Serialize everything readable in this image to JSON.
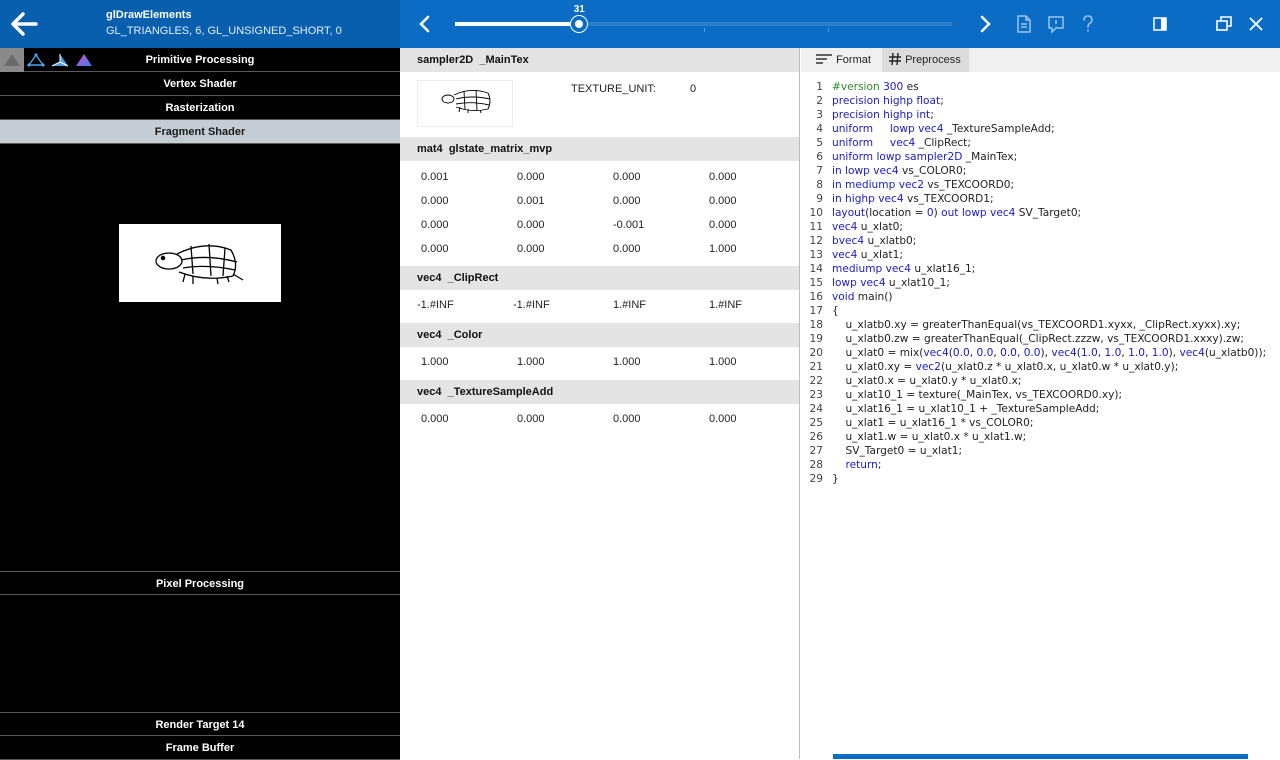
{
  "header": {
    "call_title": "glDrawElements",
    "call_args": "GL_TRIANGLES, 6, GL_UNSIGNED_SHORT, 0"
  },
  "timeline": {
    "current": "31",
    "progress": 0.25
  },
  "pipeline": {
    "stages": [
      "Primitive Processing",
      "Vertex Shader",
      "Rasterization",
      "Fragment Shader"
    ],
    "selected_stage": "Fragment Shader",
    "pixel_processing": "Pixel Processing",
    "render_target": "Render Target 14",
    "frame_buffer": "Frame Buffer"
  },
  "uniforms": {
    "tex": {
      "type": "sampler2D",
      "name": "_MainTex",
      "label": "TEXTURE_UNIT:",
      "value": "0"
    },
    "mvp": {
      "type": "mat4",
      "name": "glstate_matrix_mvp",
      "rows": [
        [
          "0.001",
          "0.000",
          "0.000",
          "0.000"
        ],
        [
          "0.000",
          "0.001",
          "0.000",
          "0.000"
        ],
        [
          "0.000",
          "0.000",
          "-0.001",
          "0.000"
        ],
        [
          "0.000",
          "0.000",
          "0.000",
          "1.000"
        ]
      ]
    },
    "cliprect": {
      "type": "vec4",
      "name": "_ClipRect",
      "values": [
        "-1.#INF",
        "-1.#INF",
        "1.#INF",
        "1.#INF"
      ]
    },
    "color": {
      "type": "vec4",
      "name": "_Color",
      "values": [
        "1.000",
        "1.000",
        "1.000",
        "1.000"
      ]
    },
    "texadd": {
      "type": "vec4",
      "name": "_TextureSampleAdd",
      "values": [
        "0.000",
        "0.000",
        "0.000",
        "0.000"
      ]
    }
  },
  "source": {
    "tabs": [
      "Format",
      "Preprocess"
    ],
    "lines": [
      "#version 300 es",
      "precision highp float;",
      "precision highp int;",
      "uniform     lowp vec4 _TextureSampleAdd;",
      "uniform     vec4 _ClipRect;",
      "uniform lowp sampler2D _MainTex;",
      "in lowp vec4 vs_COLOR0;",
      "in mediump vec2 vs_TEXCOORD0;",
      "in highp vec4 vs_TEXCOORD1;",
      "layout(location = 0) out lowp vec4 SV_Target0;",
      "vec4 u_xlat0;",
      "bvec4 u_xlatb0;",
      "vec4 u_xlat1;",
      "mediump vec4 u_xlat16_1;",
      "lowp vec4 u_xlat10_1;",
      "void main()",
      "{",
      "    u_xlatb0.xy = greaterThanEqual(vs_TEXCOORD1.xyxx, _ClipRect.xyxx).xy;",
      "    u_xlatb0.zw = greaterThanEqual(_ClipRect.zzzw, vs_TEXCOORD1.xxxy).zw;",
      "    u_xlat0 = mix(vec4(0.0, 0.0, 0.0, 0.0), vec4(1.0, 1.0, 1.0, 1.0), vec4(u_xlatb0));",
      "    u_xlat0.xy = vec2(u_xlat0.z * u_xlat0.x, u_xlat0.w * u_xlat0.y);",
      "    u_xlat0.x = u_xlat0.y * u_xlat0.x;",
      "    u_xlat10_1 = texture(_MainTex, vs_TEXCOORD0.xy);",
      "    u_xlat16_1 = u_xlat10_1 + _TextureSampleAdd;",
      "    u_xlat1 = u_xlat16_1 * vs_COLOR0;",
      "    u_xlat1.w = u_xlat0.x * u_xlat1.w;",
      "    SV_Target0 = u_xlat1;",
      "    return;",
      "}"
    ]
  },
  "colors": {
    "accent": "#0a6cc4",
    "header_dark": "#075fae",
    "selected_stage": "#c5ccd3",
    "keyword": "#1b1bc8",
    "preprocessor": "#2e8b2e"
  },
  "icons": [
    "back-arrow-icon",
    "chevron-left-icon",
    "chevron-right-icon",
    "document-icon",
    "comment-icon",
    "help-icon",
    "panel-icon",
    "restore-icon",
    "close-icon",
    "triangle-icon",
    "wire-triangle-icon",
    "vertex-triangle-icon",
    "color-triangle-icon",
    "format-icon",
    "hash-icon",
    "turtle-icon"
  ]
}
